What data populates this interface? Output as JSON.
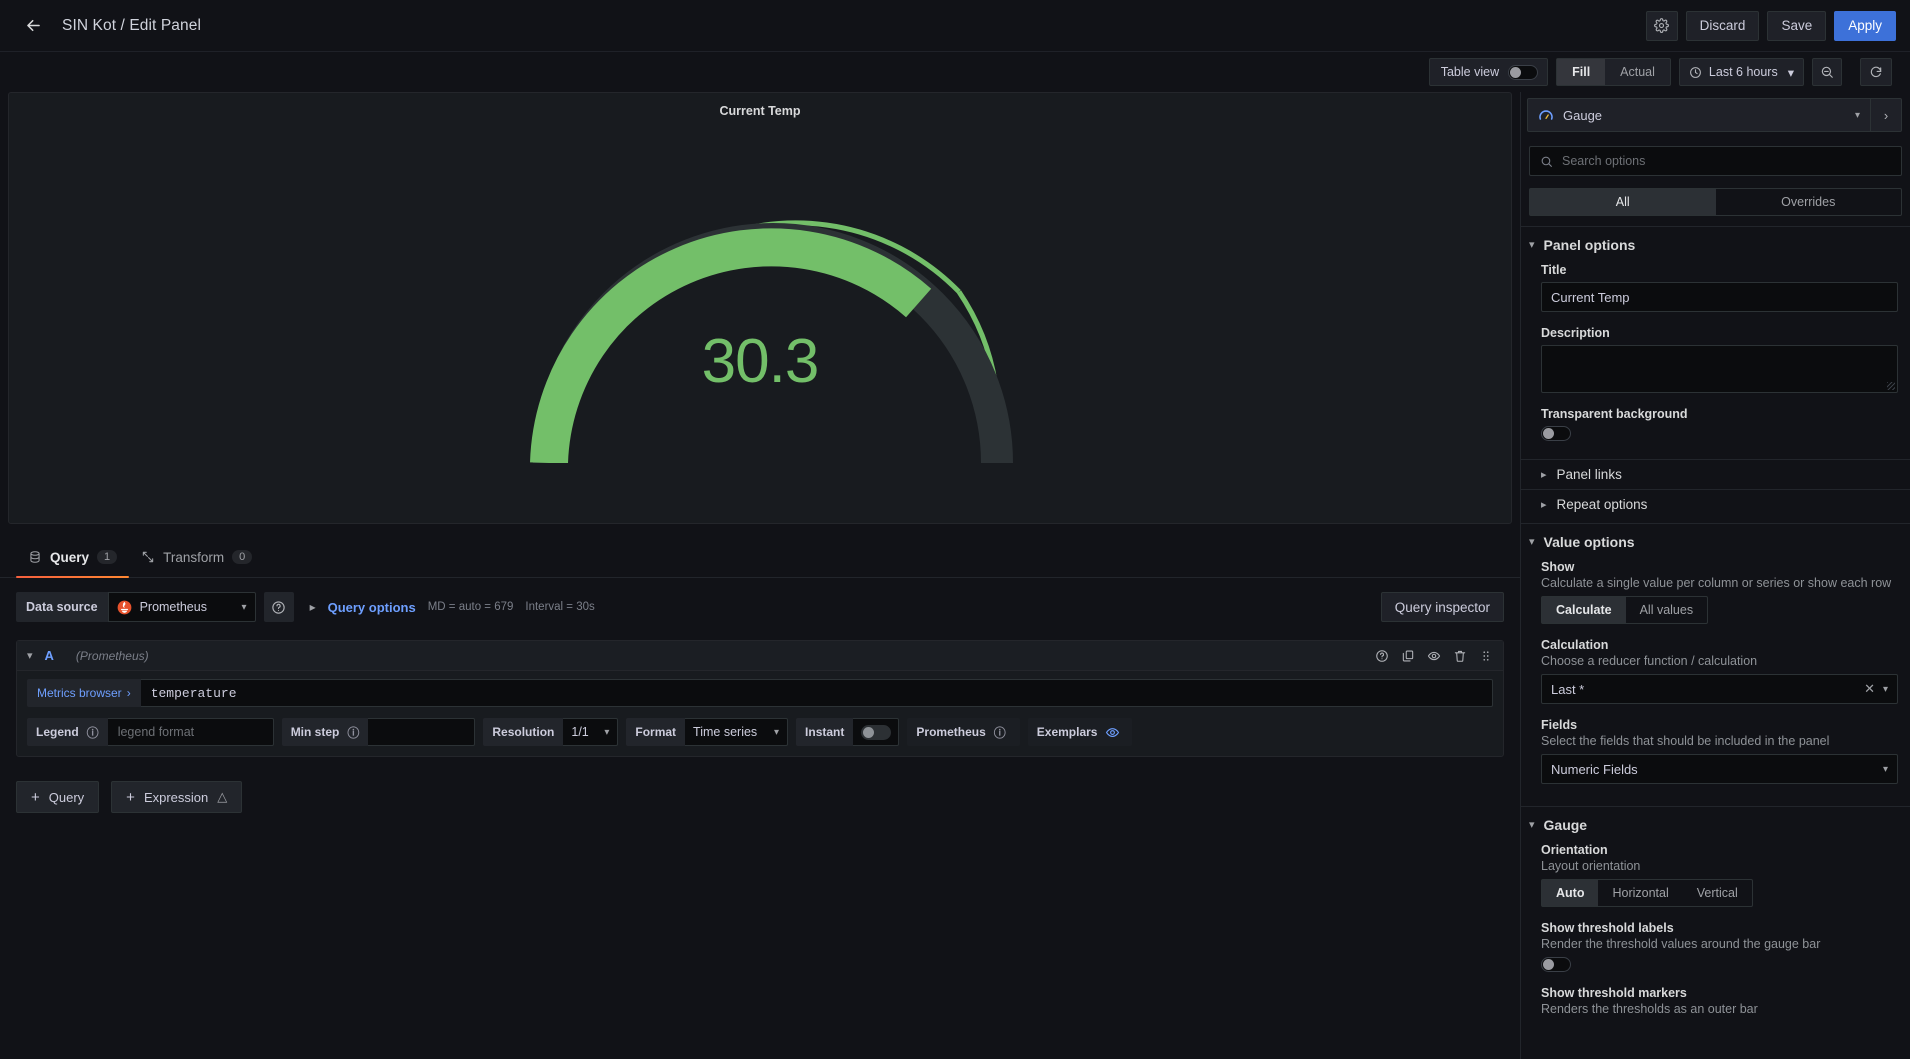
{
  "topbar": {
    "back_icon": "arrow-left-icon",
    "breadcrumb": "SIN Kot / Edit Panel",
    "settings_icon": "gear-icon",
    "discard_label": "Discard",
    "save_label": "Save",
    "apply_label": "Apply"
  },
  "subbar": {
    "table_view_label": "Table view",
    "fill_label": "Fill",
    "actual_label": "Actual",
    "time_range": "Last 6 hours",
    "zoom_out_icon": "zoom-out-icon",
    "refresh_icon": "refresh-icon"
  },
  "panel": {
    "title": "Current Temp"
  },
  "chart_data": {
    "type": "gauge",
    "title": "Current Temp",
    "value": 30.3,
    "display_value": "30.3",
    "min": 0,
    "max": 40,
    "value_color": "#73bf69",
    "fraction_filled": 0.757,
    "start_angle_deg": -110,
    "end_angle_deg": 110,
    "thresholds": [
      {
        "value": 0,
        "color": "#73bf69"
      },
      {
        "value": 34,
        "color": "#eab839"
      },
      {
        "value": 37,
        "color": "#ff780a"
      }
    ],
    "track_color": "#2c3235",
    "threshold_marker_ring": true,
    "legend": "none",
    "grid": false
  },
  "query_editor": {
    "tabs": [
      {
        "label": "Query",
        "count": "1",
        "icon": "database-icon",
        "active": true
      },
      {
        "label": "Transform",
        "count": "0",
        "icon": "transform-icon",
        "active": false
      }
    ],
    "data_source_label": "Data source",
    "data_source_value": "Prometheus",
    "datasource_help_icon": "help-circle-icon",
    "query_options_label": "Query options",
    "query_options_meta_md": "MD = auto = 679",
    "query_options_meta_interval": "Interval = 30s",
    "query_inspector_label": "Query inspector",
    "query_row": {
      "ref_id": "A",
      "datasource_note": "(Prometheus)",
      "icons": [
        "help-circle-icon",
        "duplicate-icon",
        "eye-icon",
        "trash-icon",
        "drag-handle-icon"
      ],
      "metrics_browser_label": "Metrics browser",
      "expression": "temperature",
      "legend_label": "Legend",
      "legend_placeholder": "legend format",
      "min_step_label": "Min step",
      "min_step_value": "",
      "resolution_label": "Resolution",
      "resolution_value": "1/1",
      "format_label": "Format",
      "format_value": "Time series",
      "instant_label": "Instant",
      "instant_on": false,
      "prometheus_label": "Prometheus",
      "exemplars_label": "Exemplars",
      "exemplars_icon": "eye-icon"
    },
    "add_query_label": "Query",
    "add_expression_label": "Expression",
    "expression_warn_icon": "warning-triangle-icon"
  },
  "options_pane": {
    "viz_name": "Gauge",
    "viz_icon": "gauge-icon",
    "search_placeholder": "Search options",
    "search_icon": "search-icon",
    "tab_all": "All",
    "tab_overrides": "Overrides",
    "panel_options": {
      "section_title": "Panel options",
      "title_label": "Title",
      "title_value": "Current Temp",
      "description_label": "Description",
      "description_value": "",
      "transparent_label": "Transparent background",
      "transparent_on": false,
      "panel_links_label": "Panel links",
      "repeat_options_label": "Repeat options"
    },
    "value_options": {
      "section_title": "Value options",
      "show_label": "Show",
      "show_desc": "Calculate a single value per column or series or show each row",
      "show_calculate": "Calculate",
      "show_all_values": "All values",
      "calculation_label": "Calculation",
      "calculation_desc": "Choose a reducer function / calculation",
      "calculation_value": "Last *",
      "fields_label": "Fields",
      "fields_desc": "Select the fields that should be included in the panel",
      "fields_value": "Numeric Fields"
    },
    "gauge_options": {
      "section_title": "Gauge",
      "orientation_label": "Orientation",
      "orientation_desc": "Layout orientation",
      "orientation_auto": "Auto",
      "orientation_horizontal": "Horizontal",
      "orientation_vertical": "Vertical",
      "threshold_labels_label": "Show threshold labels",
      "threshold_labels_desc": "Render the threshold values around the gauge bar",
      "threshold_labels_on": false,
      "threshold_markers_label": "Show threshold markers",
      "threshold_markers_desc": "Renders the thresholds as an outer bar"
    }
  }
}
